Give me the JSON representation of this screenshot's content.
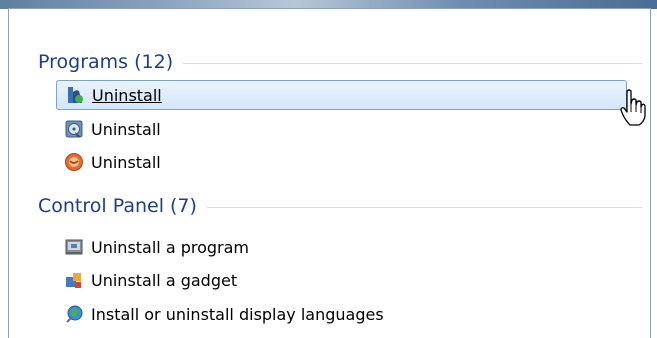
{
  "groups": [
    {
      "title": "Programs (12)",
      "items": [
        {
          "label": "Uninstall",
          "icon": "installer-icon",
          "selected": true
        },
        {
          "label": "Uninstall",
          "icon": "setup-disc-icon",
          "selected": false
        },
        {
          "label": "Uninstall",
          "icon": "orange-app-icon",
          "selected": false
        }
      ]
    },
    {
      "title": "Control Panel (7)",
      "items": [
        {
          "label": "Uninstall a program",
          "icon": "programs-features-icon",
          "selected": false
        },
        {
          "label": "Uninstall a gadget",
          "icon": "gadgets-icon",
          "selected": false
        },
        {
          "label": "Install or uninstall display languages",
          "icon": "globe-language-icon",
          "selected": false
        }
      ]
    }
  ],
  "colors": {
    "group_title": "#1e3e8c",
    "selection_border": "#7da2ce",
    "selection_fill": "#d4e6fb"
  }
}
